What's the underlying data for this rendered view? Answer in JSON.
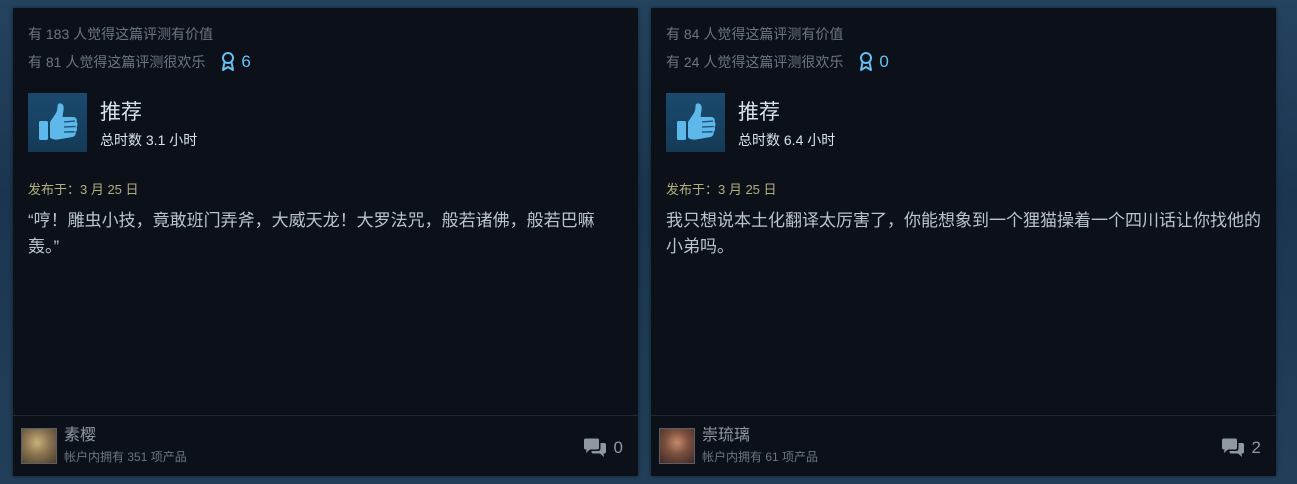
{
  "reviews": [
    {
      "helpful_text": "有 183 人觉得这篇评测有价值",
      "funny_text": "有 81 人觉得这篇评测很欢乐",
      "award_count": "6",
      "verdict": "推荐",
      "playtime": "总时数 3.1 小时",
      "posted": "发布于：3 月 25 日",
      "text": "“哼！雕虫小技，竟敢班门弄斧，大威天龙！大罗法咒，般若诸佛，般若巴嘛轰。”",
      "author": "素樱",
      "products_owned": "帐户内拥有 351 项产品",
      "comment_count": "0"
    },
    {
      "helpful_text": "有 84 人觉得这篇评测有价值",
      "funny_text": "有 24 人觉得这篇评测很欢乐",
      "award_count": "0",
      "verdict": "推荐",
      "playtime": "总时数 6.4 小时",
      "posted": "发布于：3 月 25 日",
      "text": "我只想说本土化翻译太厉害了，你能想象到一个狸猫操着一个四川话让你找他的小弟吗。",
      "author": "崇琉璃",
      "products_owned": "帐户内拥有 61 项产品",
      "comment_count": "2"
    }
  ],
  "icons": {
    "thumb": "thumbs-up-icon",
    "award": "award-ribbon-icon",
    "comment": "comment-bubbles-icon"
  },
  "colors": {
    "accent": "#66c0f4",
    "card_bg": "#0c1119",
    "verdict_bg": "#1a4a6e",
    "posted": "#b3b07f"
  }
}
